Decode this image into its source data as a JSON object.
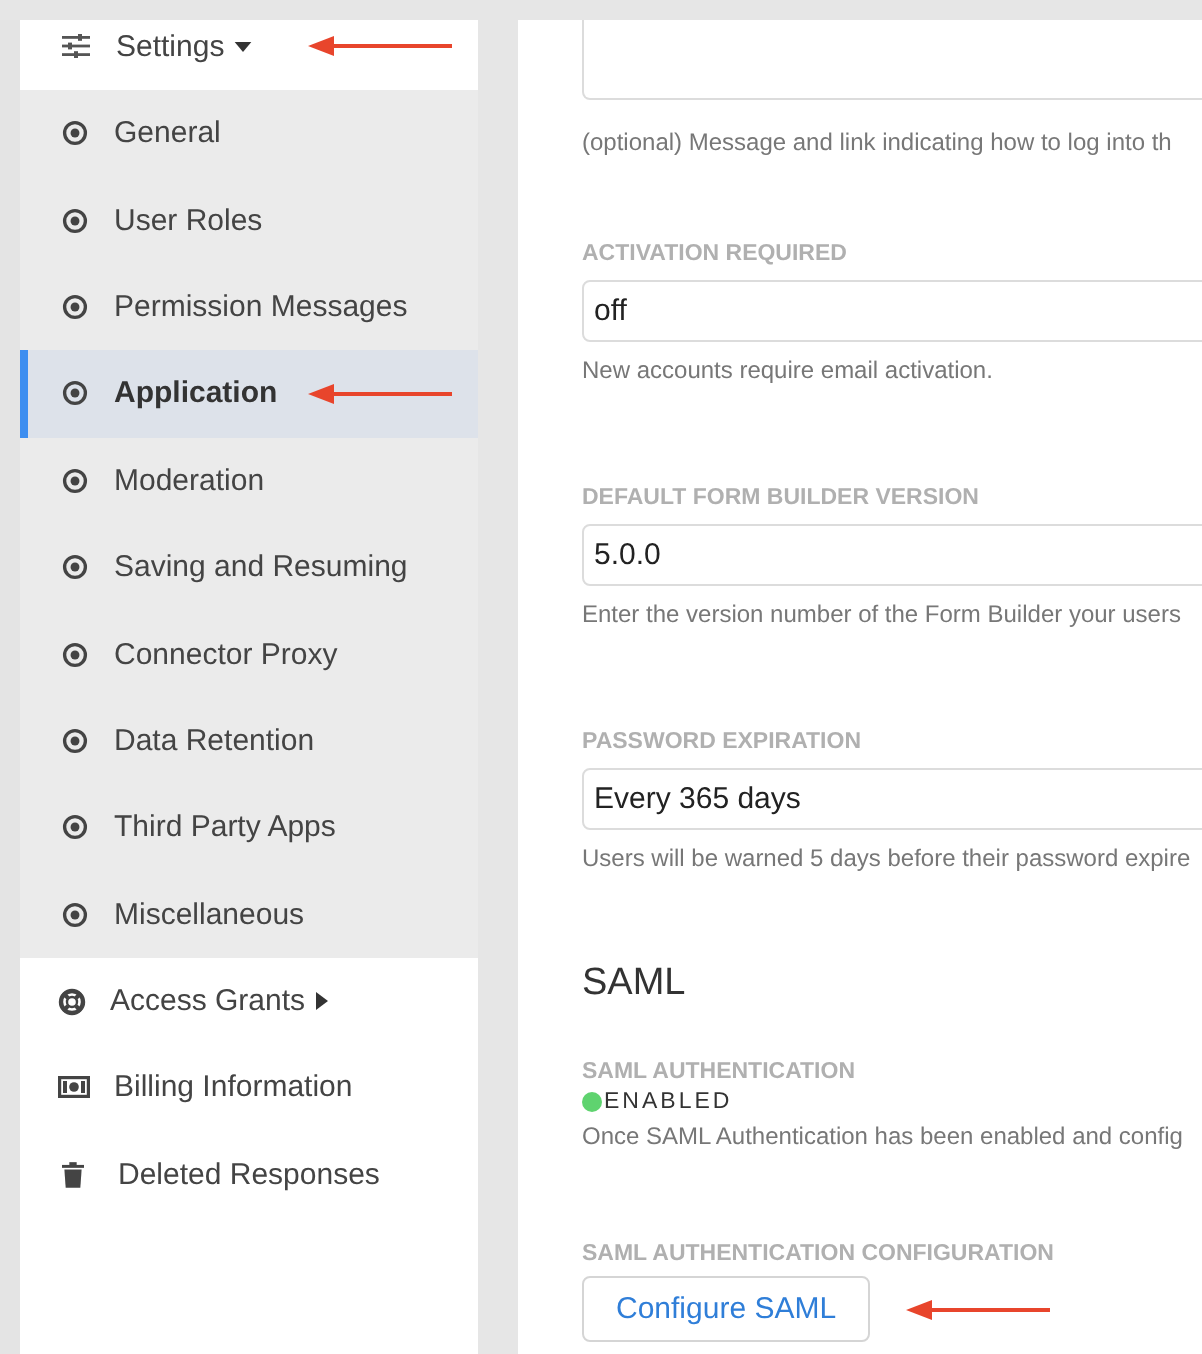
{
  "sidebar": {
    "settings": {
      "label": "Settings",
      "expanded": true,
      "children": [
        {
          "label": "General",
          "selected": false
        },
        {
          "label": "User Roles",
          "selected": false
        },
        {
          "label": "Permission Messages",
          "selected": false
        },
        {
          "label": "Application",
          "selected": true
        },
        {
          "label": "Moderation",
          "selected": false
        },
        {
          "label": "Saving and Resuming",
          "selected": false
        },
        {
          "label": "Connector Proxy",
          "selected": false
        },
        {
          "label": "Data Retention",
          "selected": false
        },
        {
          "label": "Third Party Apps",
          "selected": false
        },
        {
          "label": "Miscellaneous",
          "selected": false
        }
      ]
    },
    "items": [
      {
        "label": "Access Grants",
        "kind": "lifebuoy",
        "submenu": true
      },
      {
        "label": "Billing Information",
        "kind": "money",
        "submenu": false
      },
      {
        "label": "Deleted Responses",
        "kind": "trash",
        "submenu": false
      }
    ]
  },
  "content": {
    "top_hint": "(optional) Message and link indicating how to log into th",
    "fields": [
      {
        "label": "ACTIVATION REQUIRED",
        "value": "off",
        "help": "New accounts require email activation."
      },
      {
        "label": "DEFAULT FORM BUILDER VERSION",
        "value": "5.0.0",
        "help": "Enter the version number of the Form Builder your users"
      },
      {
        "label": "PASSWORD EXPIRATION",
        "value": "Every 365 days",
        "help": "Users will be warned 5 days before their password expire"
      }
    ],
    "section_title": "SAML",
    "saml_auth": {
      "label": "SAML AUTHENTICATION",
      "status": "ENABLED",
      "enabled": true,
      "help": "Once SAML Authentication has been enabled and config"
    },
    "saml_config": {
      "label": "SAML AUTHENTICATION CONFIGURATION",
      "button": "Configure SAML"
    }
  }
}
